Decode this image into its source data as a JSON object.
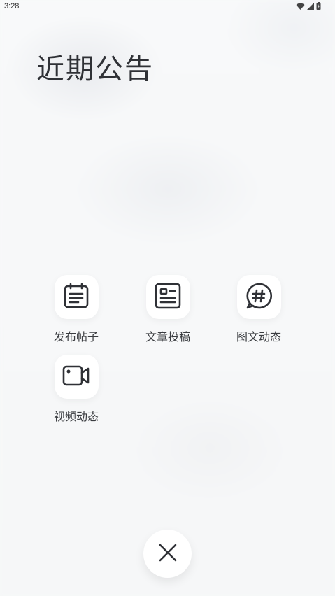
{
  "status_bar": {
    "time": "3:28",
    "icons": [
      "wifi-icon",
      "signal-icon",
      "battery-icon"
    ]
  },
  "page": {
    "title": "近期公告"
  },
  "actions": [
    {
      "label": "发布帖子",
      "icon": "calendar-note-icon"
    },
    {
      "label": "文章投稿",
      "icon": "article-icon"
    },
    {
      "label": "图文动态",
      "icon": "hashtag-chat-icon"
    },
    {
      "label": "视频动态",
      "icon": "video-camera-icon"
    }
  ],
  "close": {
    "icon": "close-icon"
  },
  "colors": {
    "background": "#f7f8f9",
    "tile": "#ffffff",
    "icon": "#2f3136",
    "text": "#3a3c40"
  }
}
